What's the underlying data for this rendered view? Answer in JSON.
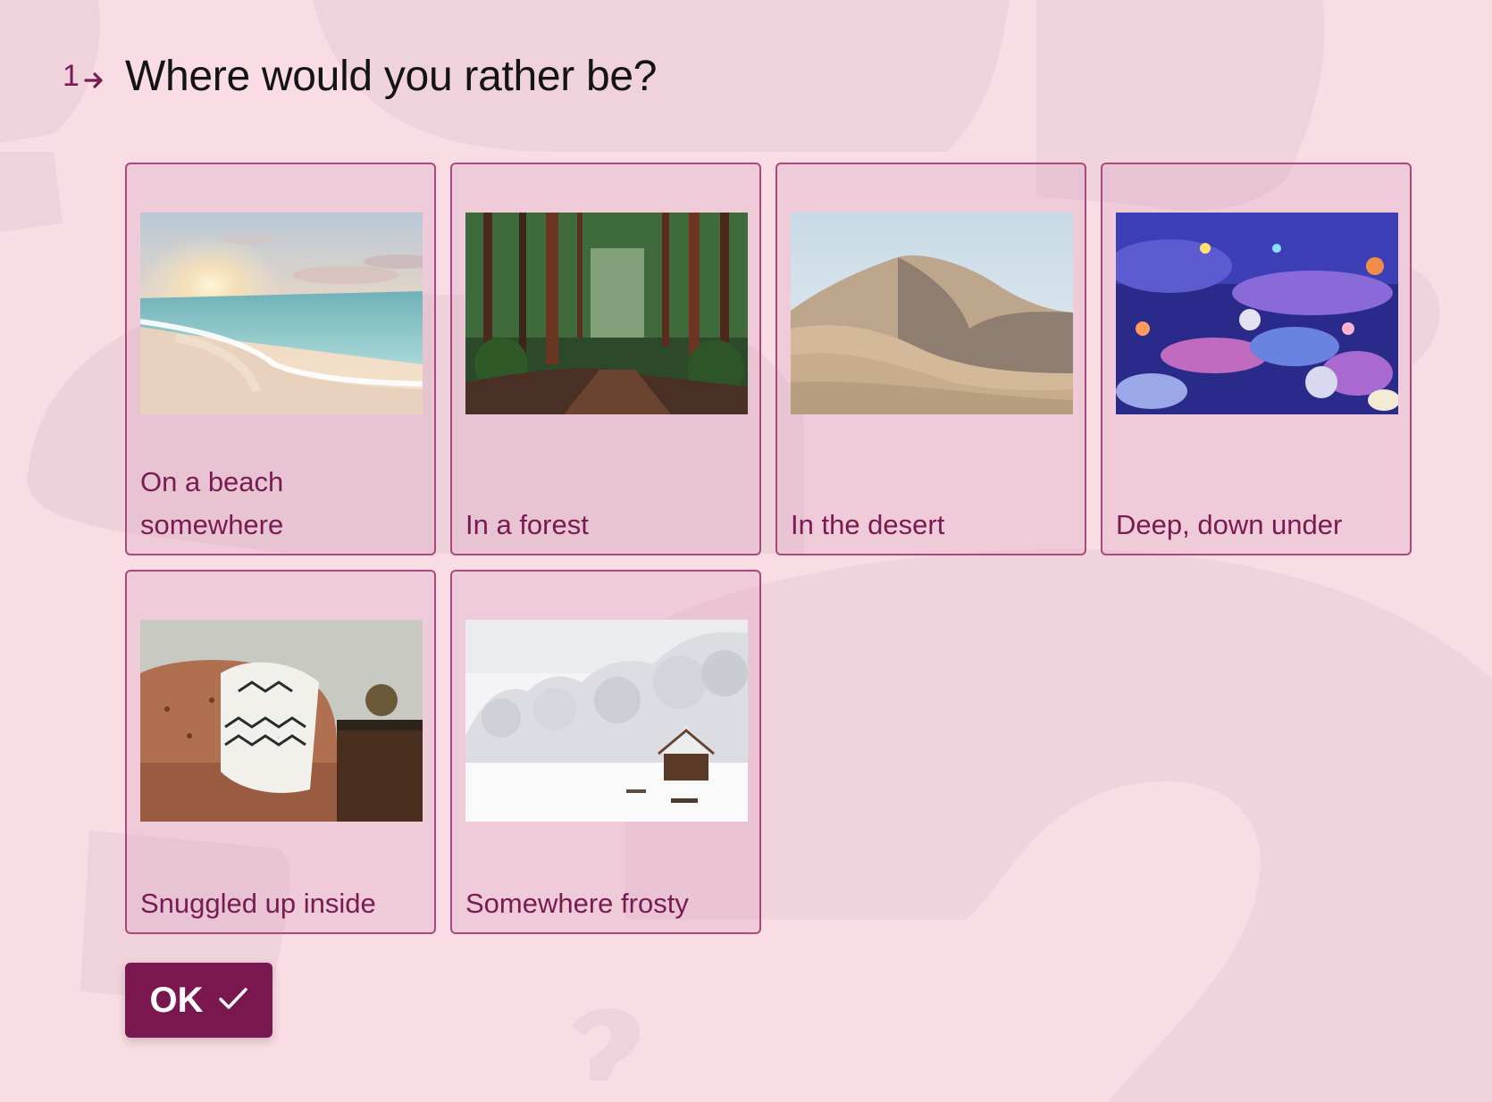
{
  "colors": {
    "background": "#f9dce4",
    "accent": "#7a1750",
    "option_text": "#7a1a52",
    "card_border": "#a84a7c",
    "question_text": "#141414"
  },
  "question": {
    "number": "1",
    "number_icon": "arrow-right-icon",
    "title": "Where would you rather be?"
  },
  "options": [
    {
      "label": "On a beach somewhere",
      "image": "beach-sunset-photo"
    },
    {
      "label": "In a forest",
      "image": "forest-path-photo"
    },
    {
      "label": "In the desert",
      "image": "desert-dunes-photo"
    },
    {
      "label": "Deep, down under",
      "image": "coral-reef-photo"
    },
    {
      "label": "Snuggled up inside",
      "image": "armchair-blanket-photo"
    },
    {
      "label": "Somewhere frosty",
      "image": "snowy-cabin-photo"
    }
  ],
  "submit": {
    "label": "OK",
    "icon": "checkmark-icon"
  }
}
